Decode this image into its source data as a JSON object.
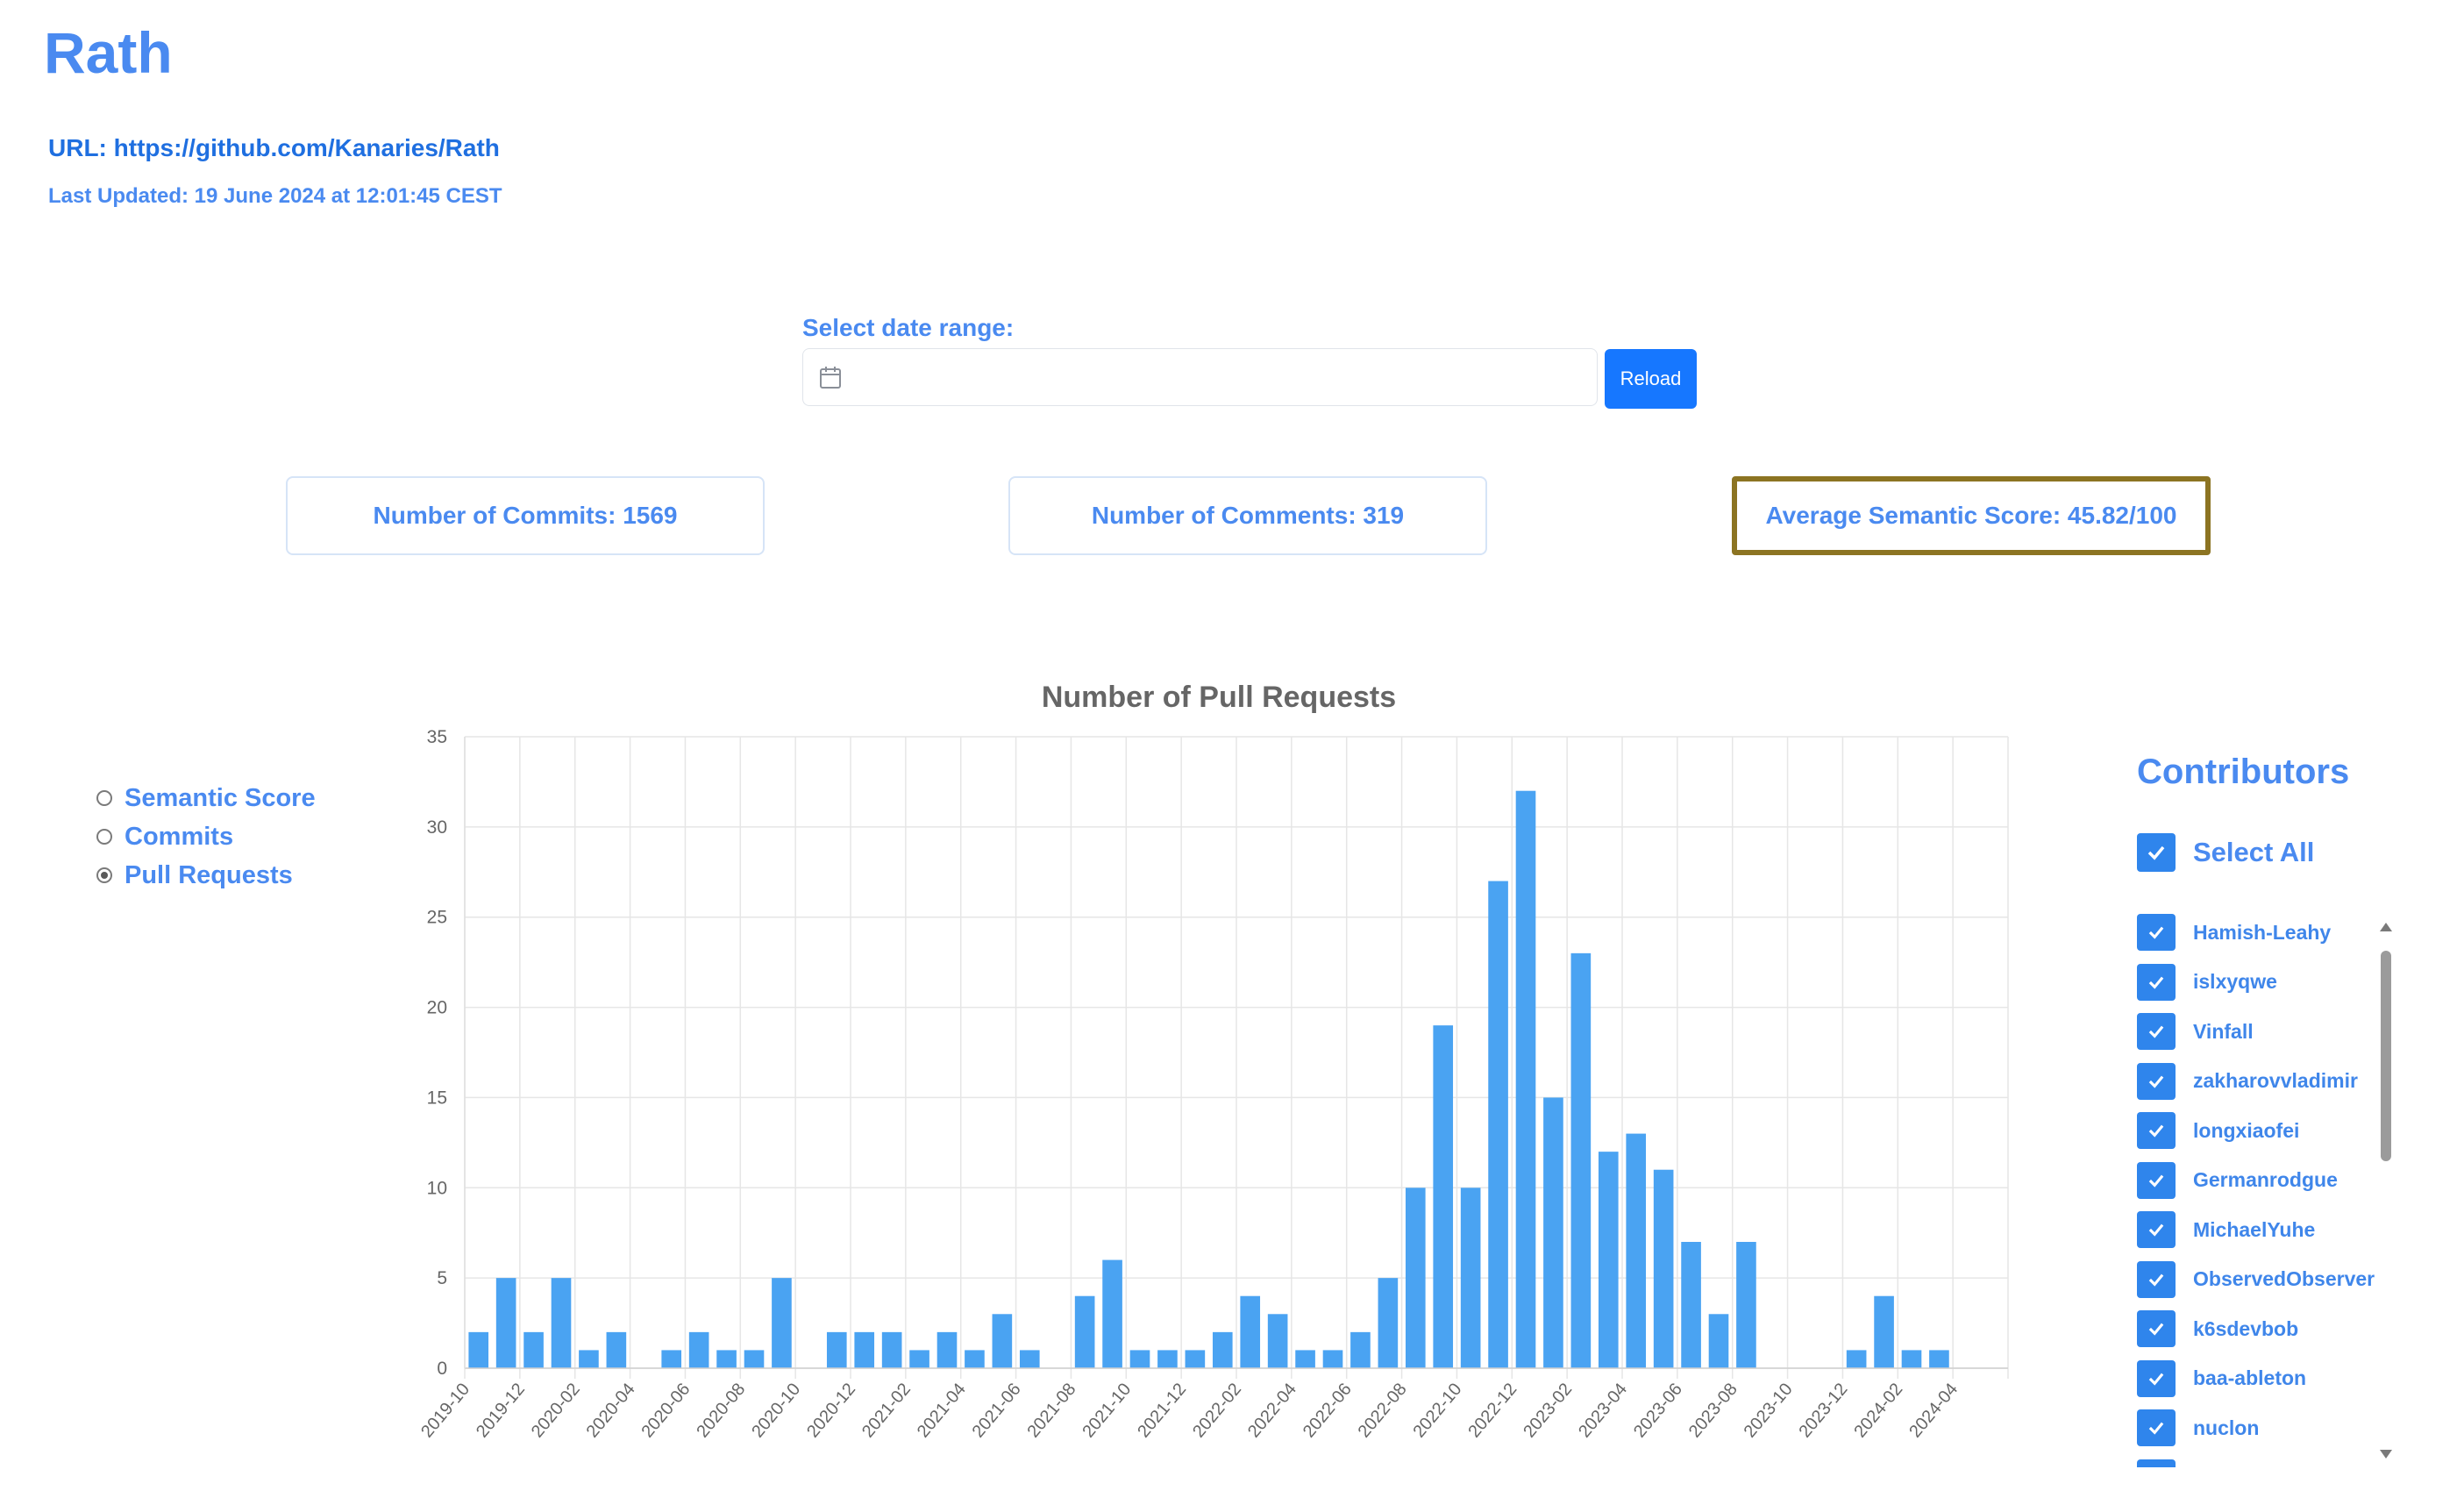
{
  "header": {
    "title": "Rath",
    "url": "URL: https://github.com/Kanaries/Rath",
    "last_updated": "Last Updated: 19 June 2024 at 12:01:45 CEST"
  },
  "date_range": {
    "label": "Select date range:",
    "value": "",
    "reload_label": "Reload"
  },
  "stats": {
    "commits": "Number of Commits: 1569",
    "comments": "Number of Comments: 319",
    "score": "Average Semantic Score: 45.82/100"
  },
  "metric_options": [
    {
      "label": "Semantic Score",
      "checked": false
    },
    {
      "label": "Commits",
      "checked": false
    },
    {
      "label": "Pull Requests",
      "checked": true
    }
  ],
  "contributors": {
    "title": "Contributors",
    "select_all_label": "Select All",
    "names": [
      "Hamish-Leahy",
      "islxyqwe",
      "Vinfall",
      "zakharovvladimir",
      "longxiaofei",
      "Germanrodgue",
      "MichaelYuhe",
      "ObservedObserver",
      "k6sdevbob",
      "baa-ableton",
      "nuclon"
    ]
  },
  "colors": {
    "accent": "#4a8af0",
    "bar": "#4aa3f2",
    "highlight_border": "#8c7422",
    "button": "#1677ff"
  },
  "chart_data": {
    "type": "bar",
    "title": "Number of Pull Requests",
    "xlabel": "",
    "ylabel": "",
    "ylim": [
      0,
      35
    ],
    "yticks": [
      0,
      5,
      10,
      15,
      20,
      25,
      30,
      35
    ],
    "grid": true,
    "categories": [
      "2019-10",
      "2019-11",
      "2019-12",
      "2020-01",
      "2020-02",
      "2020-03",
      "2020-04",
      "2020-05",
      "2020-06",
      "2020-07",
      "2020-08",
      "2020-09",
      "2020-10",
      "2020-11",
      "2020-12",
      "2021-01",
      "2021-02",
      "2021-03",
      "2021-04",
      "2021-05",
      "2021-06",
      "2021-07",
      "2021-08",
      "2021-09",
      "2021-10",
      "2021-11",
      "2021-12",
      "2022-01",
      "2022-02",
      "2022-03",
      "2022-04",
      "2022-05",
      "2022-06",
      "2022-07",
      "2022-08",
      "2022-09",
      "2022-10",
      "2022-11",
      "2022-12",
      "2023-01",
      "2023-02",
      "2023-03",
      "2023-04",
      "2023-05",
      "2023-06",
      "2023-07",
      "2023-08",
      "2023-09",
      "2023-10",
      "2023-11",
      "2023-12",
      "2024-01",
      "2024-02",
      "2024-03",
      "2024-04",
      "2024-05"
    ],
    "tick_labels": [
      "2019-10",
      "2019-12",
      "2020-02",
      "2020-04",
      "2020-06",
      "2020-08",
      "2020-10",
      "2020-12",
      "2021-02",
      "2021-04",
      "2021-06",
      "2021-08",
      "2021-10",
      "2021-12",
      "2022-02",
      "2022-04",
      "2022-06",
      "2022-08",
      "2022-10",
      "2022-12",
      "2023-02",
      "2023-04",
      "2023-06",
      "2023-08",
      "2023-10",
      "2023-12",
      "2024-02",
      "2024-04"
    ],
    "values": [
      2,
      5,
      2,
      5,
      1,
      2,
      0,
      1,
      2,
      1,
      1,
      5,
      0,
      2,
      2,
      2,
      1,
      2,
      1,
      3,
      1,
      0,
      4,
      6,
      1,
      1,
      1,
      2,
      4,
      3,
      1,
      1,
      2,
      5,
      10,
      19,
      10,
      27,
      32,
      15,
      23,
      12,
      13,
      11,
      7,
      3,
      7,
      0,
      0,
      0,
      1,
      4,
      1,
      1,
      0,
      0
    ]
  }
}
